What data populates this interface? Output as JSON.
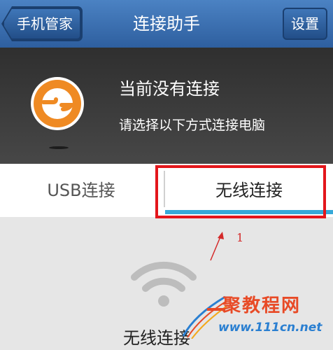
{
  "header": {
    "back_label": "手机管家",
    "title": "连接助手",
    "settings_label": "设置"
  },
  "status": {
    "title": "当前没有连接",
    "subtitle": "请选择以下方式连接电脑"
  },
  "tabs": [
    {
      "label": "USB连接",
      "selected": false
    },
    {
      "label": "无线连接",
      "selected": true
    }
  ],
  "annotation": {
    "number": "1",
    "highlight_color": "#e3161b"
  },
  "content": {
    "mode_label": "无线连接"
  },
  "watermark": {
    "site_name": "聚教程网",
    "url": "www.111cn.net"
  },
  "colors": {
    "accent": "#36a9d8",
    "logo_orange": "#ef8a23",
    "header_blue": "#3a6fb0"
  }
}
